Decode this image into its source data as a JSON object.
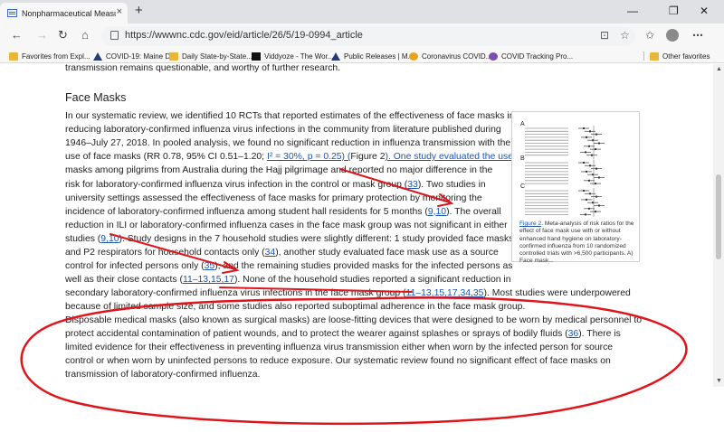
{
  "browser": {
    "tab": {
      "title": "Nonpharmaceutical Measures fo",
      "close": "×"
    },
    "new_tab": "+",
    "window": {
      "minimize": "—",
      "maximize": "❐",
      "close": "✕"
    },
    "nav": {
      "back": "←",
      "forward": "→",
      "reload": "↻",
      "home": "⌂"
    },
    "url": "https://wwwnc.cdc.gov/eid/article/26/5/19-0994_article",
    "tools": {
      "reading": "⊡",
      "star": "☆",
      "favorites": "✩",
      "more": "⋯"
    }
  },
  "favorites_bar": {
    "items": [
      {
        "label": "Favorites from Expl...",
        "icon": "folder-icon"
      },
      {
        "label": "COVID-19: Maine D...",
        "icon": "triangle-icon"
      },
      {
        "label": "Daily State-by-State...",
        "icon": "folder-icon"
      },
      {
        "label": "Viddyoze - The Wor...",
        "icon": "v-icon"
      },
      {
        "label": "Public Releases | M...",
        "icon": "triangle-icon"
      },
      {
        "label": "Coronavirus COVID...",
        "icon": "globe-icon"
      },
      {
        "label": "COVID Tracking Pro...",
        "icon": "circle-icon"
      }
    ],
    "other": "Other favorites"
  },
  "article": {
    "prev_tail": "transmission remains questionable, and worthy of further research.",
    "heading": "Face Masks",
    "p1_lines": [
      [
        "In our systematic review, we identified 10 RCTs that reported estimates of the effectiveness of face masks in"
      ],
      [
        "reducing laboratory-confirmed influenza virus infections in the community from literature published during"
      ],
      [
        "1946–July 27, 2018. In pooled analysis, we found no significant reduction in influenza transmission with the"
      ],
      [
        "use of face masks (RR 0.78, 95% CI 0.51–1.20; ",
        "I² = 30%, p = 0.25) (",
        "Figure 2",
        "). One study evaluated the use of"
      ],
      [
        "masks among pilgrims from Australia during the Hajj pilgrimage and reported no major difference in the"
      ],
      [
        "risk for laboratory-confirmed influenza virus infection in the control or mask group (",
        "33",
        "). Two studies in"
      ],
      [
        "university settings assessed the effectiveness of face masks for primary protection by monitoring the"
      ],
      [
        "incidence of laboratory-confirmed influenza among student hall residents for 5 months (",
        "9,10",
        "). The overall"
      ],
      [
        "reduction in ILI or laboratory-confirmed influenza cases in the face mask group was not significant in either"
      ],
      [
        "studies (",
        "9,10",
        "). Study designs in the 7 household studies were slightly different: 1 study provided face masks"
      ],
      [
        "and P2 respirators for household contacts only (",
        "34",
        "), another study evaluated face mask use as a source"
      ],
      [
        "control for infected persons only (",
        "35",
        "), and the remaining studies provided masks for the infected persons as"
      ],
      [
        "well as their close contacts (",
        "11–13,15,17",
        "). None of the household studies reported a significant reduction in"
      ],
      [
        "secondary laboratory-confirmed influenza virus infections in the face mask group (",
        "11–13,15,17,34,35",
        "). Most studies were underpowered"
      ],
      [
        "because of limited sample size, and some studies also reported suboptimal adherence in the face mask group."
      ]
    ],
    "p2_lines": [
      [
        "Disposable medical masks (also known as surgical masks) are loose-fitting devices that were designed to be worn by medical personnel to"
      ],
      [
        "protect accidental contamination of patient wounds, and to protect the wearer against splashes or sprays of bodily fluids (",
        "36",
        "). There is"
      ],
      [
        "limited evidence for their effectiveness in preventing influenza virus transmission either when worn by the infected person for source"
      ],
      [
        "control or when worn by uninfected persons to reduce exposure. Our systematic review found no significant effect of face masks on"
      ],
      [
        "transmission of laboratory-confirmed influenza."
      ]
    ],
    "figure": {
      "panel_a": "A",
      "panel_b": "B",
      "panel_c": "C",
      "caption_link": "Figure 2",
      "caption_rest": ". Meta-analysis of risk ratios for the effect of face mask use with or without enhanced hand hygiene on laboratory-confirmed influenza from 10 randomized controlled trials with >6,500 participants. A) Face mask..."
    }
  },
  "scrollbar": {
    "up": "▲",
    "down": "▼"
  },
  "colors": {
    "annotation": "#e0141b",
    "link": "#1a55b2"
  }
}
